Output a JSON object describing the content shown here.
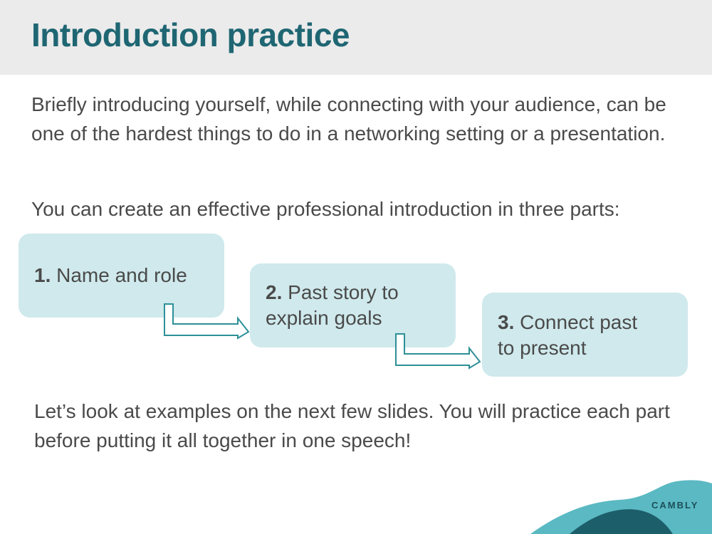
{
  "slide": {
    "title": "Introduction practice",
    "intro_text": "Briefly introducing yourself, while connecting with your audience, can be one of the hardest things to do in a networking setting or a presentation.",
    "lead_text": "You can create an effective professional introduction in three parts:",
    "outro_text": "Let’s look at examples on the next few slides. You will practice each part before putting it all together in one speech!"
  },
  "steps": [
    {
      "number": "1.",
      "line1": " Name and role",
      "line2": ""
    },
    {
      "number": "2.",
      "line1": " Past story to",
      "line2": "explain goals"
    },
    {
      "number": "3.",
      "line1": " Connect past",
      "line2": "to present"
    }
  ],
  "brand": {
    "logo_text": "CAMBLY"
  },
  "colors": {
    "title": "#1f6673",
    "header_bg": "#ebebeb",
    "step_box": "#cfe9ec",
    "arrow": "#2d8f98",
    "blob_light": "#5ab9c2",
    "blob_dark": "#1d5e6b"
  }
}
